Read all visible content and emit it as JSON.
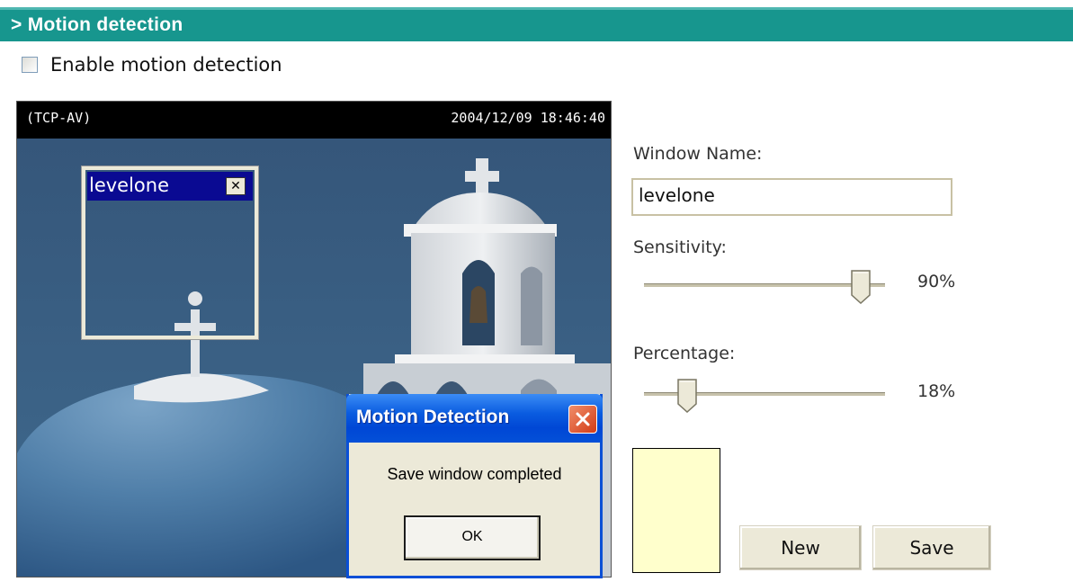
{
  "header": {
    "title": "> Motion detection"
  },
  "enable": {
    "label": "Enable motion detection",
    "checked": false
  },
  "video": {
    "stream_name": "(TCP-AV)",
    "timestamp": "2004/12/09 18:46:40"
  },
  "motion_window": {
    "name": "levelone",
    "close_label": "✕"
  },
  "dialog": {
    "title": "Motion Detection",
    "message": "Save window completed",
    "ok_label": "OK"
  },
  "controls": {
    "window_name_label": "Window Name:",
    "window_name_value": "levelone",
    "sensitivity_label": "Sensitivity:",
    "sensitivity_value": "90%",
    "sensitivity_percent": 90,
    "percentage_label": "Percentage:",
    "percentage_value": "18%",
    "percentage_percent": 18,
    "swatch_color": "#ffffcc",
    "new_label": "New",
    "save_label": "Save"
  },
  "colors": {
    "header": "#17968e",
    "motion_window_bar": "#0a0a92",
    "dialog_title": "#0a5ce0"
  }
}
